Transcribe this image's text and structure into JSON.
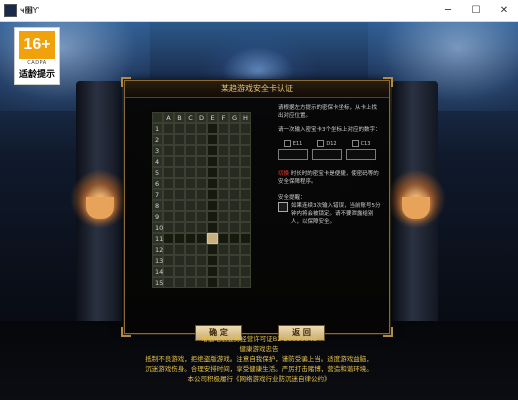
{
  "window": {
    "title": "ҹ׫Ƴ",
    "minimize_glyph": "─",
    "maximize_glyph": "☐",
    "close_glyph": "✕"
  },
  "age_badge": {
    "rating": "16+",
    "org": "CADPA",
    "tip": "适龄提示",
    "color": "#f1a20b"
  },
  "dialog": {
    "title": "某趋游戏安全卡认证",
    "columns": [
      "A",
      "B",
      "C",
      "D",
      "E",
      "F",
      "G",
      "H"
    ],
    "rows": [
      "1",
      "2",
      "3",
      "4",
      "5",
      "6",
      "7",
      "8",
      "9",
      "10",
      "11",
      "12",
      "13",
      "14",
      "15"
    ],
    "highlight": {
      "row": "11",
      "column": "E"
    },
    "right_panel": {
      "instruction": "请根据左方提示的密保卡坐标，从卡上找出对应位置。",
      "input_prompt": "请一次输入密宝卡3个坐标上对应的数字：",
      "coords": [
        {
          "label": "E11",
          "value": ""
        },
        {
          "label": "D12",
          "value": ""
        },
        {
          "label": "C13",
          "value": ""
        }
      ],
      "red_note_prefix": "切换",
      "red_note_rest": "  时长时的密宝卡是便捷，使密码等的安全保障程序。",
      "warning_title": "安全提醒：",
      "warning_text": "如果连续3次输入错误，当前账号5分钟内将会被锁定。请不要泄露给别人，以保障安全。"
    },
    "buttons": {
      "ok": "确 定",
      "back": "返 回"
    }
  },
  "footer": {
    "line1": "增值电信业务经营许可证B2-20090048",
    "line2": "健康游戏忠告",
    "line3": "抵制不良游戏，拒绝盗版游戏。注意自我保护，谨防受骗上当。适度游戏益脑，",
    "line4": "沉迷游戏伤身。合理安排时间，享受健康生活。严厉打击赌博，营造和谐环境。",
    "line5": "本公司积极履行《网络游戏行业防沉迷自律公约》"
  }
}
